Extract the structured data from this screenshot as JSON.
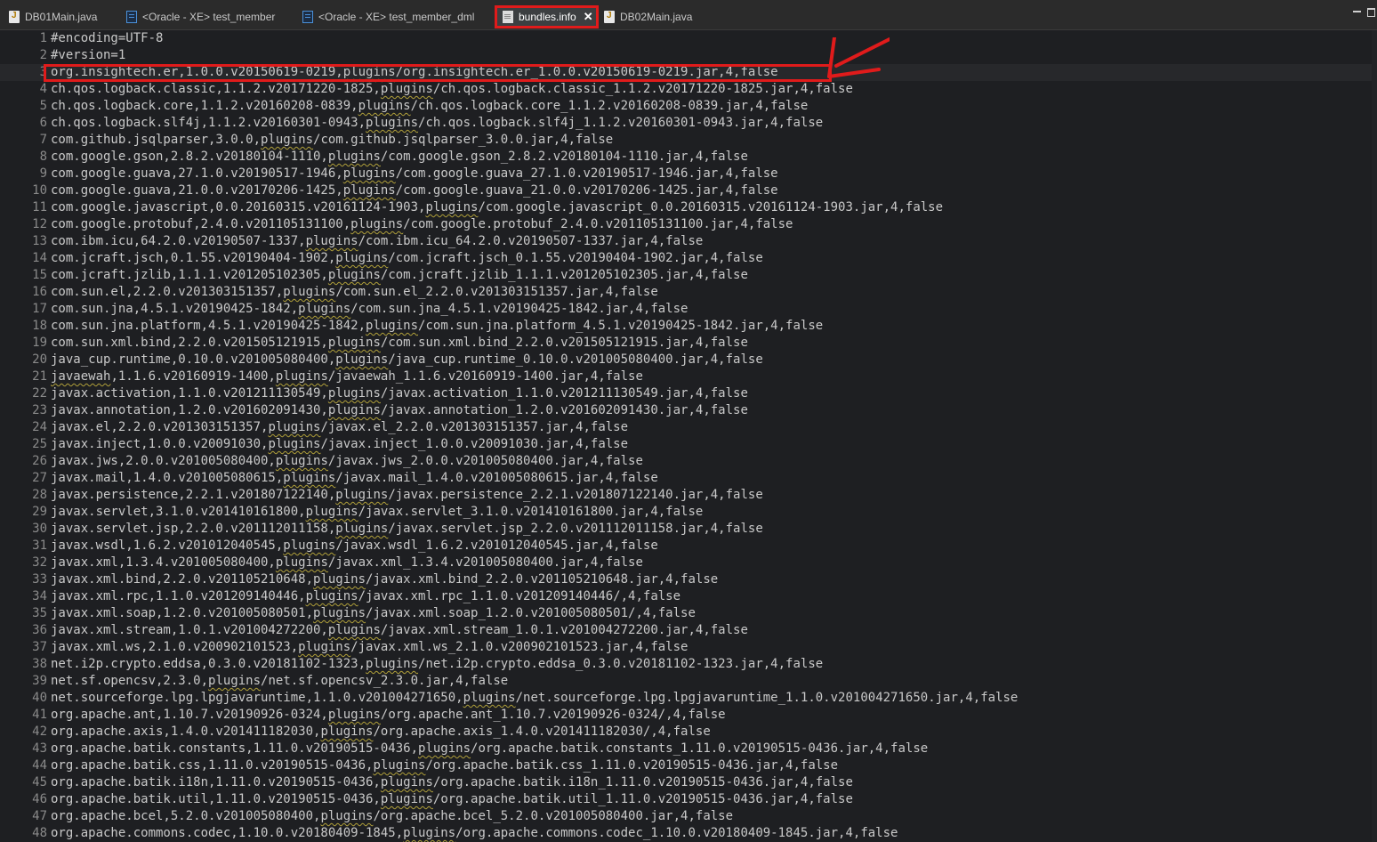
{
  "tabs": [
    {
      "label": "DB01Main.java",
      "icon": "java-file-icon"
    },
    {
      "label": "<Oracle - XE> test_member",
      "icon": "sql-file-icon"
    },
    {
      "label": "<Oracle - XE> test_member_dml",
      "icon": "sql-file-icon"
    },
    {
      "label": "bundles.info",
      "icon": "text-file-icon",
      "active": true
    },
    {
      "label": "DB02Main.java",
      "icon": "java-file-icon"
    }
  ],
  "active_tab_close": "✕",
  "annotation_color": "#e01b1b",
  "lines": [
    {
      "n": "1",
      "text": "#encoding=UTF-8"
    },
    {
      "n": "2",
      "text": "#version=1"
    },
    {
      "n": "3",
      "text": "org.insightech.er,1.0.0.v20150619-0219,plugins/org.insightech.er_1.0.0.v20150619-0219.jar,4,false"
    },
    {
      "n": "4",
      "text": "ch.qos.logback.classic,1.1.2.v20171220-1825,plugins/ch.qos.logback.classic_1.1.2.v20171220-1825.jar,4,false"
    },
    {
      "n": "5",
      "text": "ch.qos.logback.core,1.1.2.v20160208-0839,plugins/ch.qos.logback.core_1.1.2.v20160208-0839.jar,4,false"
    },
    {
      "n": "6",
      "text": "ch.qos.logback.slf4j,1.1.2.v20160301-0943,plugins/ch.qos.logback.slf4j_1.1.2.v20160301-0943.jar,4,false"
    },
    {
      "n": "7",
      "text": "com.github.jsqlparser,3.0.0,plugins/com.github.jsqlparser_3.0.0.jar,4,false"
    },
    {
      "n": "8",
      "text": "com.google.gson,2.8.2.v20180104-1110,plugins/com.google.gson_2.8.2.v20180104-1110.jar,4,false"
    },
    {
      "n": "9",
      "text": "com.google.guava,27.1.0.v20190517-1946,plugins/com.google.guava_27.1.0.v20190517-1946.jar,4,false"
    },
    {
      "n": "10",
      "text": "com.google.guava,21.0.0.v20170206-1425,plugins/com.google.guava_21.0.0.v20170206-1425.jar,4,false"
    },
    {
      "n": "11",
      "text": "com.google.javascript,0.0.20160315.v20161124-1903,plugins/com.google.javascript_0.0.20160315.v20161124-1903.jar,4,false"
    },
    {
      "n": "12",
      "text": "com.google.protobuf,2.4.0.v201105131100,plugins/com.google.protobuf_2.4.0.v201105131100.jar,4,false"
    },
    {
      "n": "13",
      "text": "com.ibm.icu,64.2.0.v20190507-1337,plugins/com.ibm.icu_64.2.0.v20190507-1337.jar,4,false"
    },
    {
      "n": "14",
      "text": "com.jcraft.jsch,0.1.55.v20190404-1902,plugins/com.jcraft.jsch_0.1.55.v20190404-1902.jar,4,false"
    },
    {
      "n": "15",
      "text": "com.jcraft.jzlib,1.1.1.v201205102305,plugins/com.jcraft.jzlib_1.1.1.v201205102305.jar,4,false"
    },
    {
      "n": "16",
      "text": "com.sun.el,2.2.0.v201303151357,plugins/com.sun.el_2.2.0.v201303151357.jar,4,false"
    },
    {
      "n": "17",
      "text": "com.sun.jna,4.5.1.v20190425-1842,plugins/com.sun.jna_4.5.1.v20190425-1842.jar,4,false"
    },
    {
      "n": "18",
      "text": "com.sun.jna.platform,4.5.1.v20190425-1842,plugins/com.sun.jna.platform_4.5.1.v20190425-1842.jar,4,false"
    },
    {
      "n": "19",
      "text": "com.sun.xml.bind,2.2.0.v201505121915,plugins/com.sun.xml.bind_2.2.0.v201505121915.jar,4,false"
    },
    {
      "n": "20",
      "text": "java_cup.runtime,0.10.0.v201005080400,plugins/java_cup.runtime_0.10.0.v201005080400.jar,4,false"
    },
    {
      "n": "21",
      "text": "javaewah,1.1.6.v20160919-1400,plugins/javaewah_1.1.6.v20160919-1400.jar,4,false"
    },
    {
      "n": "22",
      "text": "javax.activation,1.1.0.v201211130549,plugins/javax.activation_1.1.0.v201211130549.jar,4,false"
    },
    {
      "n": "23",
      "text": "javax.annotation,1.2.0.v201602091430,plugins/javax.annotation_1.2.0.v201602091430.jar,4,false"
    },
    {
      "n": "24",
      "text": "javax.el,2.2.0.v201303151357,plugins/javax.el_2.2.0.v201303151357.jar,4,false"
    },
    {
      "n": "25",
      "text": "javax.inject,1.0.0.v20091030,plugins/javax.inject_1.0.0.v20091030.jar,4,false"
    },
    {
      "n": "26",
      "text": "javax.jws,2.0.0.v201005080400,plugins/javax.jws_2.0.0.v201005080400.jar,4,false"
    },
    {
      "n": "27",
      "text": "javax.mail,1.4.0.v201005080615,plugins/javax.mail_1.4.0.v201005080615.jar,4,false"
    },
    {
      "n": "28",
      "text": "javax.persistence,2.2.1.v201807122140,plugins/javax.persistence_2.2.1.v201807122140.jar,4,false"
    },
    {
      "n": "29",
      "text": "javax.servlet,3.1.0.v201410161800,plugins/javax.servlet_3.1.0.v201410161800.jar,4,false"
    },
    {
      "n": "30",
      "text": "javax.servlet.jsp,2.2.0.v201112011158,plugins/javax.servlet.jsp_2.2.0.v201112011158.jar,4,false"
    },
    {
      "n": "31",
      "text": "javax.wsdl,1.6.2.v201012040545,plugins/javax.wsdl_1.6.2.v201012040545.jar,4,false"
    },
    {
      "n": "32",
      "text": "javax.xml,1.3.4.v201005080400,plugins/javax.xml_1.3.4.v201005080400.jar,4,false"
    },
    {
      "n": "33",
      "text": "javax.xml.bind,2.2.0.v201105210648,plugins/javax.xml.bind_2.2.0.v201105210648.jar,4,false"
    },
    {
      "n": "34",
      "text": "javax.xml.rpc,1.1.0.v201209140446,plugins/javax.xml.rpc_1.1.0.v201209140446/,4,false"
    },
    {
      "n": "35",
      "text": "javax.xml.soap,1.2.0.v201005080501,plugins/javax.xml.soap_1.2.0.v201005080501/,4,false"
    },
    {
      "n": "36",
      "text": "javax.xml.stream,1.0.1.v201004272200,plugins/javax.xml.stream_1.0.1.v201004272200.jar,4,false"
    },
    {
      "n": "37",
      "text": "javax.xml.ws,2.1.0.v200902101523,plugins/javax.xml.ws_2.1.0.v200902101523.jar,4,false"
    },
    {
      "n": "38",
      "text": "net.i2p.crypto.eddsa,0.3.0.v20181102-1323,plugins/net.i2p.crypto.eddsa_0.3.0.v20181102-1323.jar,4,false"
    },
    {
      "n": "39",
      "text": "net.sf.opencsv,2.3.0,plugins/net.sf.opencsv_2.3.0.jar,4,false"
    },
    {
      "n": "40",
      "text": "net.sourceforge.lpg.lpgjavaruntime,1.1.0.v201004271650,plugins/net.sourceforge.lpg.lpgjavaruntime_1.1.0.v201004271650.jar,4,false"
    },
    {
      "n": "41",
      "text": "org.apache.ant,1.10.7.v20190926-0324,plugins/org.apache.ant_1.10.7.v20190926-0324/,4,false"
    },
    {
      "n": "42",
      "text": "org.apache.axis,1.4.0.v201411182030,plugins/org.apache.axis_1.4.0.v201411182030/,4,false"
    },
    {
      "n": "43",
      "text": "org.apache.batik.constants,1.11.0.v20190515-0436,plugins/org.apache.batik.constants_1.11.0.v20190515-0436.jar,4,false"
    },
    {
      "n": "44",
      "text": "org.apache.batik.css,1.11.0.v20190515-0436,plugins/org.apache.batik.css_1.11.0.v20190515-0436.jar,4,false"
    },
    {
      "n": "45",
      "text": "org.apache.batik.i18n,1.11.0.v20190515-0436,plugins/org.apache.batik.i18n_1.11.0.v20190515-0436.jar,4,false"
    },
    {
      "n": "46",
      "text": "org.apache.batik.util,1.11.0.v20190515-0436,plugins/org.apache.batik.util_1.11.0.v20190515-0436.jar,4,false"
    },
    {
      "n": "47",
      "text": "org.apache.bcel,5.2.0.v201005080400,plugins/org.apache.bcel_5.2.0.v201005080400.jar,4,false"
    },
    {
      "n": "48",
      "text": "org.apache.commons.codec,1.10.0.v20180409-1845,plugins/org.apache.commons.codec_1.10.0.v20180409-1845.jar,4,false"
    }
  ]
}
